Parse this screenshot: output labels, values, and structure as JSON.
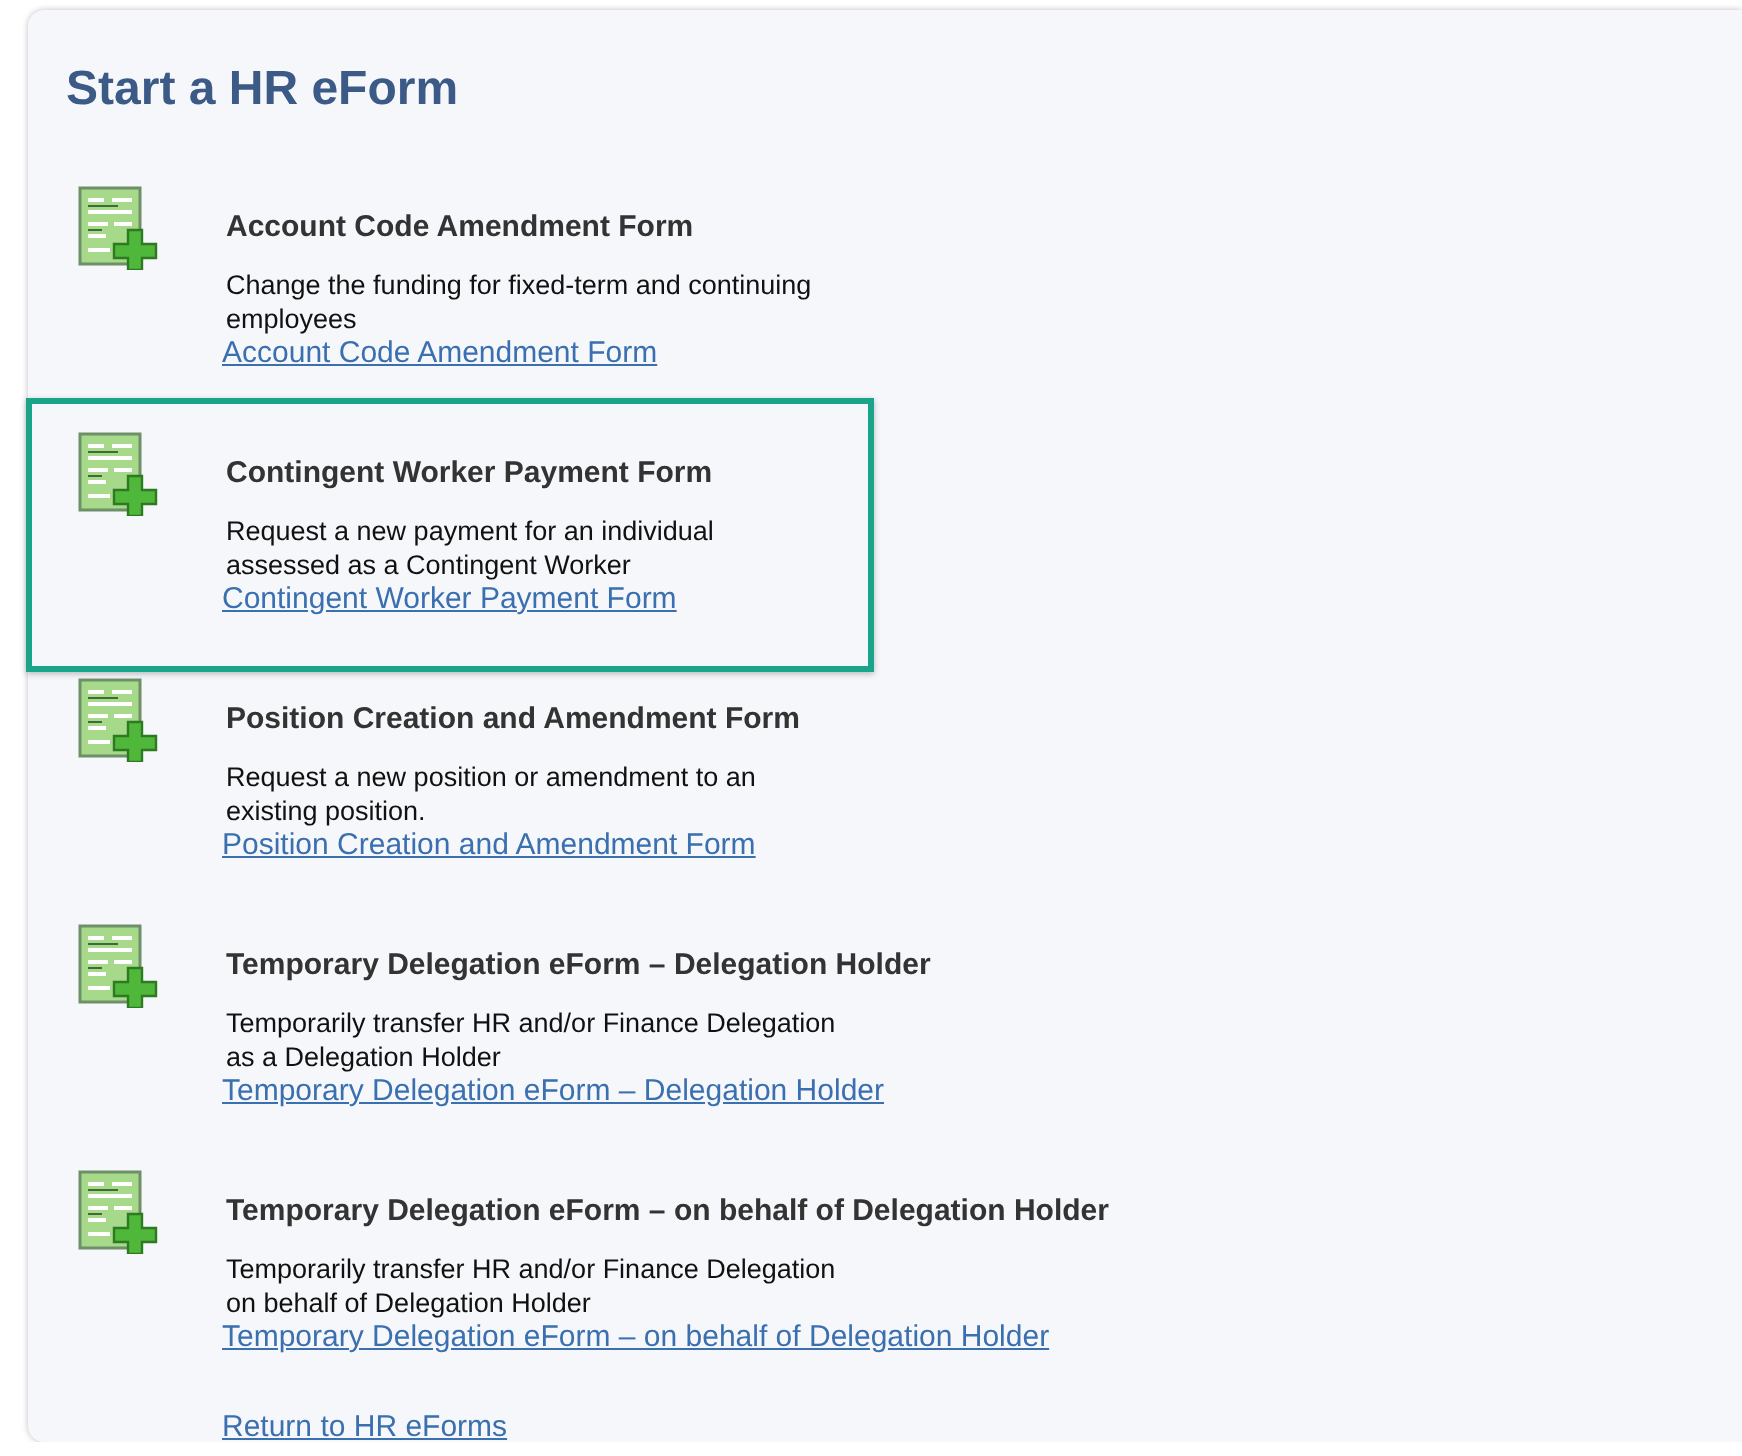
{
  "title": "Start a HR eForm",
  "forms": [
    {
      "title": "Account Code Amendment Form",
      "description_lines": [
        "Change the funding for fixed-term and continuing",
        "employees"
      ],
      "link": "Account Code Amendment Form",
      "highlighted": false
    },
    {
      "title": "Contingent Worker Payment Form",
      "description_lines": [
        "Request a new payment for an individual",
        "assessed as a Contingent Worker"
      ],
      "link": "Contingent Worker Payment Form",
      "highlighted": true
    },
    {
      "title": "Position Creation and Amendment Form",
      "description_lines": [
        "Request a new position or amendment to an",
        "existing position."
      ],
      "link": "Position Creation and Amendment Form",
      "highlighted": false
    },
    {
      "title": "Temporary Delegation eForm – Delegation Holder",
      "description_lines": [
        "Temporarily transfer HR and/or Finance Delegation",
        "as a Delegation Holder"
      ],
      "link": "Temporary Delegation eForm – Delegation Holder",
      "highlighted": false
    },
    {
      "title": "Temporary Delegation eForm – on behalf of Delegation Holder",
      "description_lines": [
        "Temporarily transfer HR and/or Finance Delegation",
        "on behalf of Delegation Holder"
      ],
      "link": "Temporary Delegation eForm – on behalf of Delegation Holder",
      "highlighted": false
    }
  ],
  "return_link": "Return to HR eForms"
}
